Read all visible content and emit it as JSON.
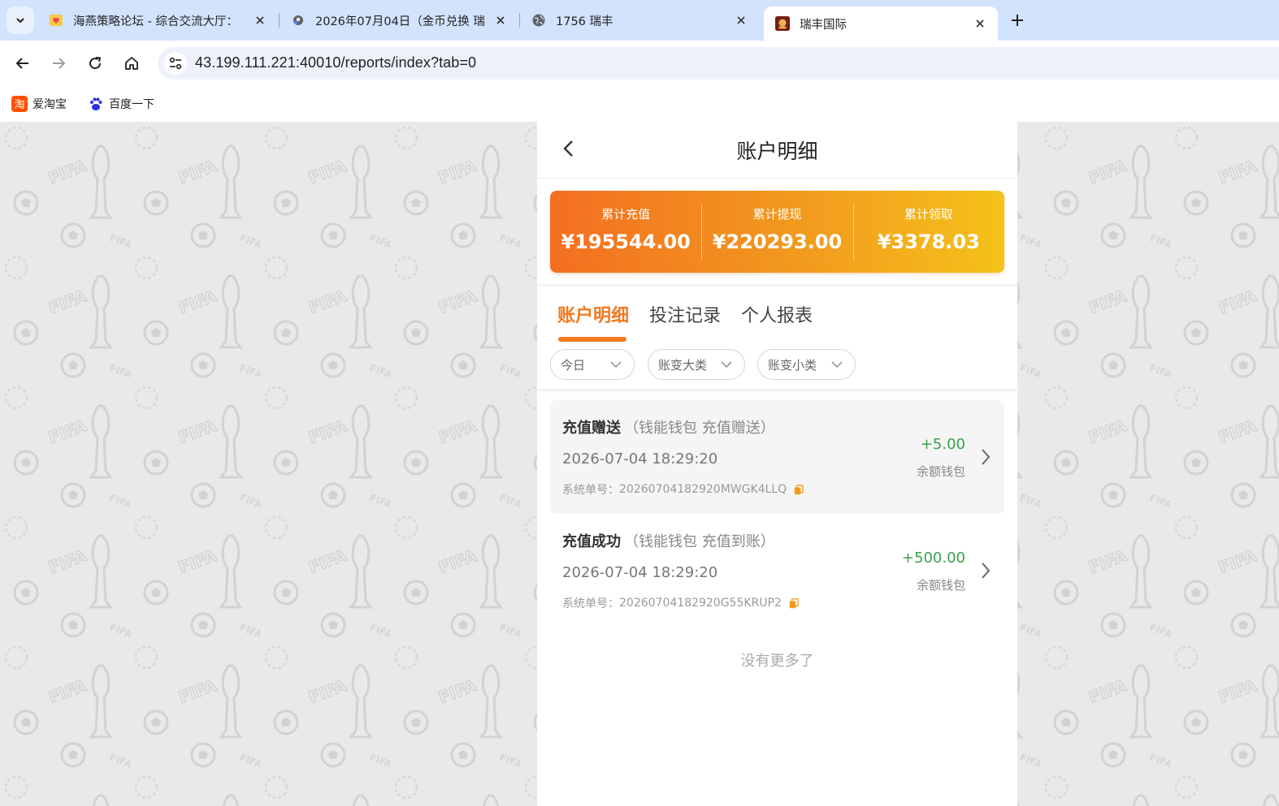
{
  "browser": {
    "tabs": [
      {
        "title": "海燕策略论坛 - 综合交流大厅：",
        "favicon": "heart-folder-icon"
      },
      {
        "title": "2026年07月04日（金币兑换 瑞",
        "favicon": "globe-pin-icon"
      },
      {
        "title": "1756 瑞丰",
        "favicon": "globe-icon"
      },
      {
        "title": "瑞丰国际",
        "favicon": "ruifeng-logo-icon",
        "active": true
      }
    ],
    "url": "43.199.111.221:40010/reports/index?tab=0",
    "bookmarks": [
      {
        "label": "爱淘宝",
        "icon": "taobao-icon"
      },
      {
        "label": "百度一下",
        "icon": "baidu-paw-icon"
      }
    ]
  },
  "app": {
    "title": "账户明细",
    "summary": [
      {
        "label": "累计充值",
        "value": "¥195544.00"
      },
      {
        "label": "累计提现",
        "value": "¥220293.00"
      },
      {
        "label": "累计领取",
        "value": "¥3378.03"
      }
    ],
    "tabs": [
      {
        "label": "账户明细",
        "active": true
      },
      {
        "label": "投注记录",
        "active": false
      },
      {
        "label": "个人报表",
        "active": false
      }
    ],
    "filters": [
      {
        "label": "今日"
      },
      {
        "label": "账变大类"
      },
      {
        "label": "账变小类"
      }
    ],
    "records": [
      {
        "type": "充值赠送",
        "sub": "（钱能钱包 充值赠送）",
        "time": "2026-07-04 18:29:20",
        "order_label": "系统单号：",
        "order_no": "20260704182920MWGK4LLQ",
        "amount": "+5.00",
        "wallet": "余额钱包"
      },
      {
        "type": "充值成功",
        "sub": "（钱能钱包 充值到账）",
        "time": "2026-07-04 18:29:20",
        "order_label": "系统单号：",
        "order_no": "20260704182920G55KRUP2",
        "amount": "+500.00",
        "wallet": "余额钱包"
      }
    ],
    "no_more": "没有更多了",
    "colors": {
      "accent": "#f27a1f",
      "positive": "#3aa04a",
      "gradient_start": "#f36f21",
      "gradient_end": "#f5c21a"
    }
  }
}
